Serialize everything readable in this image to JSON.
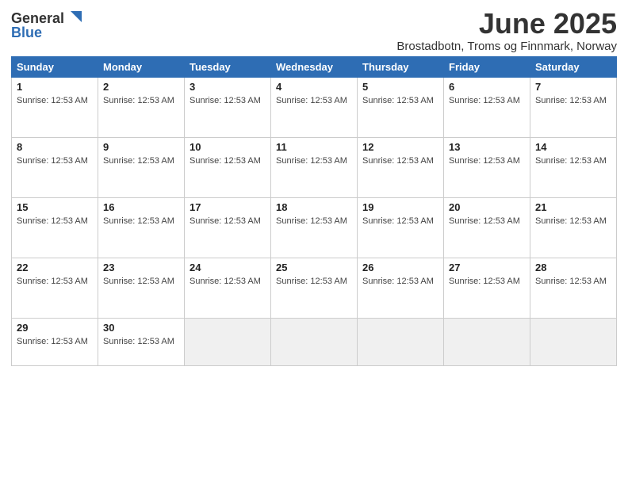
{
  "logo": {
    "general": "General",
    "blue": "Blue"
  },
  "title": {
    "month_year": "June 2025",
    "location": "Brostadbotn, Troms og Finnmark, Norway"
  },
  "days_of_week": [
    "Sunday",
    "Monday",
    "Tuesday",
    "Wednesday",
    "Thursday",
    "Friday",
    "Saturday"
  ],
  "sunrise_text": "Sunrise: 12:53 AM",
  "weeks": [
    [
      {
        "day": "1",
        "sunrise": "Sunrise: 12:53 AM"
      },
      {
        "day": "2",
        "sunrise": "Sunrise: 12:53 AM"
      },
      {
        "day": "3",
        "sunrise": "Sunrise: 12:53 AM"
      },
      {
        "day": "4",
        "sunrise": "Sunrise: 12:53 AM"
      },
      {
        "day": "5",
        "sunrise": "Sunrise: 12:53 AM"
      },
      {
        "day": "6",
        "sunrise": "Sunrise: 12:53 AM"
      },
      {
        "day": "7",
        "sunrise": "Sunrise: 12:53 AM"
      }
    ],
    [
      {
        "day": "8",
        "sunrise": "Sunrise: 12:53 AM"
      },
      {
        "day": "9",
        "sunrise": "Sunrise: 12:53 AM"
      },
      {
        "day": "10",
        "sunrise": "Sunrise: 12:53 AM"
      },
      {
        "day": "11",
        "sunrise": "Sunrise: 12:53 AM"
      },
      {
        "day": "12",
        "sunrise": "Sunrise: 12:53 AM"
      },
      {
        "day": "13",
        "sunrise": "Sunrise: 12:53 AM"
      },
      {
        "day": "14",
        "sunrise": "Sunrise: 12:53 AM"
      }
    ],
    [
      {
        "day": "15",
        "sunrise": "Sunrise: 12:53 AM"
      },
      {
        "day": "16",
        "sunrise": "Sunrise: 12:53 AM"
      },
      {
        "day": "17",
        "sunrise": "Sunrise: 12:53 AM"
      },
      {
        "day": "18",
        "sunrise": "Sunrise: 12:53 AM"
      },
      {
        "day": "19",
        "sunrise": "Sunrise: 12:53 AM"
      },
      {
        "day": "20",
        "sunrise": "Sunrise: 12:53 AM"
      },
      {
        "day": "21",
        "sunrise": "Sunrise: 12:53 AM"
      }
    ],
    [
      {
        "day": "22",
        "sunrise": "Sunrise: 12:53 AM"
      },
      {
        "day": "23",
        "sunrise": "Sunrise: 12:53 AM"
      },
      {
        "day": "24",
        "sunrise": "Sunrise: 12:53 AM"
      },
      {
        "day": "25",
        "sunrise": "Sunrise: 12:53 AM"
      },
      {
        "day": "26",
        "sunrise": "Sunrise: 12:53 AM"
      },
      {
        "day": "27",
        "sunrise": "Sunrise: 12:53 AM"
      },
      {
        "day": "28",
        "sunrise": "Sunrise: 12:53 AM"
      }
    ],
    [
      {
        "day": "29",
        "sunrise": "Sunrise: 12:53 AM"
      },
      {
        "day": "30",
        "sunrise": "Sunrise: 12:53 AM"
      },
      null,
      null,
      null,
      null,
      null
    ]
  ]
}
